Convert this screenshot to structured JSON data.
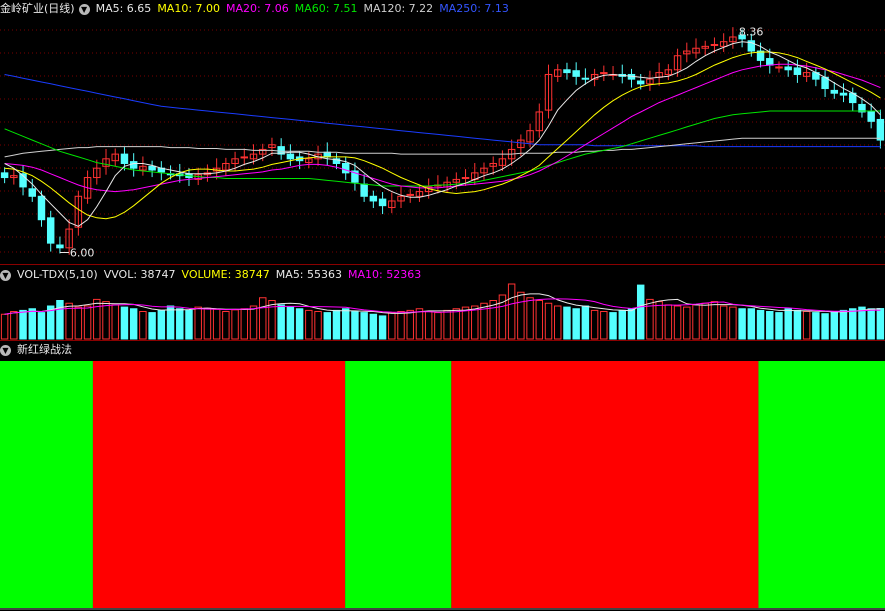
{
  "colors": {
    "up": "#ff3232",
    "down": "#54ffff",
    "ma5": "#e8e8e8",
    "ma10": "#ffff00",
    "ma20": "#ff00ff",
    "ma60": "#00e600",
    "ma120": "#cfcfcf",
    "ma250": "#1a3cff",
    "green": "#00ff00",
    "red": "#ff0000",
    "grid": "#7a0000"
  },
  "price_header": {
    "symbol": "金岭矿业(日线)",
    "ma5": "MA5: 6.65",
    "ma10": "MA10: 7.00",
    "ma20": "MA20: 7.06",
    "ma60": "MA60: 7.51",
    "ma120": "MA120: 7.22",
    "ma250": "MA250: 7.13"
  },
  "vol_header": {
    "name": "VOL-TDX(5,10)",
    "vvol": "VVOL: 38747",
    "volume": "VOLUME: 38747",
    "ma5": "MA5: 55363",
    "ma10": "MA10: 52363"
  },
  "rg_header": {
    "name": "新红绿战法"
  },
  "annotations": {
    "high_label": "8.36",
    "low_label": "6.00"
  },
  "chart_data": [
    {
      "type": "candlestick",
      "title": "金岭矿业(日线)",
      "ylim": [
        5.92,
        8.46
      ],
      "ma_last": {
        "MA5": 6.65,
        "MA10": 7.0,
        "MA20": 7.06,
        "MA60": 7.51,
        "MA120": 7.22,
        "MA250": 7.13
      },
      "closes": [
        6.8,
        6.82,
        6.7,
        6.6,
        6.35,
        6.1,
        6.05,
        6.25,
        6.6,
        6.8,
        6.9,
        7.0,
        7.05,
        6.95,
        6.9,
        6.92,
        6.88,
        6.86,
        6.84,
        6.82,
        6.8,
        6.83,
        6.85,
        6.9,
        6.95,
        7.0,
        7.02,
        7.05,
        7.1,
        7.15,
        7.05,
        7.0,
        6.98,
        7.0,
        7.05,
        7.02,
        6.95,
        6.85,
        6.75,
        6.6,
        6.55,
        6.5,
        6.55,
        6.6,
        6.62,
        6.65,
        6.7,
        6.72,
        6.75,
        6.78,
        6.8,
        6.85,
        6.9,
        6.95,
        7.0,
        7.1,
        7.2,
        7.3,
        7.5,
        7.9,
        7.95,
        7.92,
        7.88,
        7.85,
        7.9,
        7.92,
        7.9,
        7.88,
        7.85,
        7.8,
        7.85,
        7.92,
        7.95,
        8.1,
        8.15,
        8.18,
        8.2,
        8.22,
        8.25,
        8.3,
        8.28,
        8.15,
        8.05,
        8.0,
        7.98,
        7.95,
        7.9,
        7.92,
        7.85,
        7.75,
        7.7,
        7.68,
        7.6,
        7.5,
        7.4,
        7.2
      ],
      "ma5": [
        6.95,
        6.9,
        6.82,
        6.73,
        6.62,
        6.52,
        6.42,
        6.32,
        6.28,
        6.35,
        6.49,
        6.65,
        6.82,
        6.92,
        6.95,
        6.95,
        6.93,
        6.9,
        6.88,
        6.86,
        6.84,
        6.84,
        6.84,
        6.85,
        6.87,
        6.9,
        6.94,
        6.97,
        7.01,
        7.06,
        7.06,
        7.07,
        7.07,
        7.05,
        7.02,
        7.0,
        6.99,
        6.97,
        6.93,
        6.85,
        6.77,
        6.7,
        6.65,
        6.61,
        6.59,
        6.59,
        6.61,
        6.64,
        6.67,
        6.71,
        6.74,
        6.78,
        6.82,
        6.85,
        6.89,
        6.95,
        7.02,
        7.1,
        7.2,
        7.35,
        7.52,
        7.63,
        7.73,
        7.8,
        7.86,
        7.89,
        7.9,
        7.89,
        7.88,
        7.87,
        7.86,
        7.87,
        7.88,
        7.92,
        7.97,
        8.04,
        8.1,
        8.15,
        8.19,
        8.23,
        8.25,
        8.24,
        8.2,
        8.14,
        8.1,
        8.05,
        8.0,
        7.97,
        7.92,
        7.87,
        7.81,
        7.75,
        7.7,
        7.64,
        7.57,
        7.47
      ],
      "ma10": [
        6.9,
        6.89,
        6.86,
        6.82,
        6.76,
        6.69,
        6.61,
        6.53,
        6.46,
        6.4,
        6.37,
        6.36,
        6.38,
        6.43,
        6.5,
        6.58,
        6.66,
        6.74,
        6.8,
        6.85,
        6.88,
        6.89,
        6.89,
        6.88,
        6.87,
        6.87,
        6.88,
        6.89,
        6.91,
        6.94,
        6.96,
        6.98,
        7.0,
        7.01,
        7.02,
        7.02,
        7.02,
        7.02,
        7.01,
        6.98,
        6.94,
        6.9,
        6.85,
        6.8,
        6.76,
        6.72,
        6.68,
        6.66,
        6.64,
        6.63,
        6.64,
        6.65,
        6.67,
        6.7,
        6.73,
        6.77,
        6.82,
        6.87,
        6.93,
        7.02,
        7.11,
        7.2,
        7.29,
        7.38,
        7.47,
        7.55,
        7.62,
        7.68,
        7.73,
        7.77,
        7.79,
        7.8,
        7.81,
        7.83,
        7.86,
        7.9,
        7.95,
        8.0,
        8.04,
        8.08,
        8.11,
        8.13,
        8.14,
        8.14,
        8.13,
        8.11,
        8.08,
        8.04,
        8.0,
        7.96,
        7.91,
        7.86,
        7.81,
        7.76,
        7.71,
        7.65
      ],
      "ma20": [
        6.95,
        6.94,
        6.93,
        6.91,
        6.88,
        6.84,
        6.8,
        6.76,
        6.72,
        6.69,
        6.67,
        6.66,
        6.65,
        6.66,
        6.67,
        6.69,
        6.71,
        6.73,
        6.75,
        6.77,
        6.78,
        6.79,
        6.8,
        6.81,
        6.82,
        6.83,
        6.84,
        6.85,
        6.86,
        6.88,
        6.89,
        6.91,
        6.93,
        6.94,
        6.94,
        6.93,
        6.91,
        6.88,
        6.85,
        6.82,
        6.79,
        6.76,
        6.73,
        6.71,
        6.7,
        6.69,
        6.69,
        6.69,
        6.7,
        6.71,
        6.72,
        6.73,
        6.74,
        6.75,
        6.76,
        6.78,
        6.8,
        6.83,
        6.87,
        6.92,
        6.97,
        7.03,
        7.09,
        7.15,
        7.21,
        7.27,
        7.33,
        7.39,
        7.45,
        7.5,
        7.55,
        7.6,
        7.64,
        7.68,
        7.72,
        7.76,
        7.8,
        7.84,
        7.88,
        7.92,
        7.95,
        7.97,
        7.99,
        8.0,
        8.01,
        8.01,
        8.0,
        7.99,
        7.97,
        7.95,
        7.93,
        7.9,
        7.87,
        7.84,
        7.8,
        7.76
      ],
      "ma60": [
        7.32,
        7.28,
        7.24,
        7.2,
        7.16,
        7.12,
        7.08,
        7.05,
        7.02,
        6.99,
        6.96,
        6.94,
        6.92,
        6.9,
        6.88,
        6.87,
        6.86,
        6.85,
        6.84,
        6.83,
        6.82,
        6.81,
        6.8,
        6.8,
        6.79,
        6.79,
        6.79,
        6.79,
        6.79,
        6.79,
        6.79,
        6.79,
        6.79,
        6.79,
        6.78,
        6.77,
        6.76,
        6.75,
        6.74,
        6.73,
        6.72,
        6.71,
        6.71,
        6.71,
        6.71,
        6.71,
        6.71,
        6.72,
        6.72,
        6.73,
        6.74,
        6.75,
        6.77,
        6.79,
        6.81,
        6.83,
        6.85,
        6.87,
        6.9,
        6.93,
        6.96,
        6.99,
        7.02,
        7.05,
        7.07,
        7.09,
        7.11,
        7.13,
        7.16,
        7.19,
        7.22,
        7.25,
        7.28,
        7.31,
        7.34,
        7.37,
        7.4,
        7.43,
        7.45,
        7.47,
        7.48,
        7.49,
        7.5,
        7.51,
        7.51,
        7.51,
        7.51,
        7.51,
        7.51,
        7.51,
        7.51,
        7.51,
        7.51,
        7.51,
        7.51,
        7.51
      ],
      "ma120": [
        7.02,
        7.04,
        7.06,
        7.07,
        7.08,
        7.09,
        7.1,
        7.11,
        7.12,
        7.12,
        7.13,
        7.13,
        7.13,
        7.13,
        7.13,
        7.13,
        7.13,
        7.13,
        7.12,
        7.12,
        7.12,
        7.11,
        7.11,
        7.11,
        7.1,
        7.1,
        7.1,
        7.09,
        7.09,
        7.09,
        7.08,
        7.08,
        7.08,
        7.08,
        7.07,
        7.07,
        7.07,
        7.06,
        7.06,
        7.06,
        7.06,
        7.06,
        7.06,
        7.05,
        7.05,
        7.05,
        7.05,
        7.05,
        7.05,
        7.05,
        7.05,
        7.05,
        7.05,
        7.05,
        7.05,
        7.05,
        7.06,
        7.06,
        7.06,
        7.06,
        7.07,
        7.07,
        7.07,
        7.08,
        7.08,
        7.09,
        7.09,
        7.1,
        7.1,
        7.11,
        7.12,
        7.13,
        7.14,
        7.15,
        7.16,
        7.17,
        7.18,
        7.19,
        7.2,
        7.21,
        7.22,
        7.22,
        7.22,
        7.22,
        7.22,
        7.22,
        7.22,
        7.22,
        7.22,
        7.22,
        7.22,
        7.22,
        7.22,
        7.22,
        7.22,
        7.22
      ],
      "ma250": [
        7.9,
        7.88,
        7.86,
        7.84,
        7.82,
        7.8,
        7.78,
        7.76,
        7.74,
        7.72,
        7.7,
        7.68,
        7.66,
        7.64,
        7.62,
        7.6,
        7.58,
        7.56,
        7.55,
        7.54,
        7.53,
        7.52,
        7.51,
        7.5,
        7.49,
        7.48,
        7.47,
        7.46,
        7.45,
        7.44,
        7.43,
        7.42,
        7.41,
        7.4,
        7.39,
        7.38,
        7.37,
        7.36,
        7.35,
        7.34,
        7.33,
        7.32,
        7.31,
        7.3,
        7.29,
        7.28,
        7.27,
        7.26,
        7.25,
        7.24,
        7.23,
        7.22,
        7.21,
        7.2,
        7.19,
        7.18,
        7.17,
        7.16,
        7.15,
        7.15,
        7.15,
        7.15,
        7.15,
        7.15,
        7.14,
        7.14,
        7.14,
        7.14,
        7.14,
        7.14,
        7.14,
        7.14,
        7.14,
        7.14,
        7.14,
        7.14,
        7.13,
        7.13,
        7.13,
        7.13,
        7.13,
        7.13,
        7.13,
        7.13,
        7.13,
        7.13,
        7.13,
        7.13,
        7.13,
        7.13,
        7.13,
        7.13,
        7.13,
        7.13,
        7.13,
        7.13
      ]
    },
    {
      "type": "bar",
      "title": "VOL-TDX(5,10)",
      "ylim": [
        0,
        100000
      ],
      "volumes": [
        45000,
        50000,
        52000,
        55000,
        48000,
        60000,
        70000,
        65000,
        58000,
        60000,
        72000,
        68000,
        62000,
        58000,
        55000,
        50000,
        48000,
        52000,
        60000,
        55000,
        52000,
        58000,
        56000,
        54000,
        50000,
        53000,
        55000,
        60000,
        75000,
        70000,
        62000,
        58000,
        55000,
        52000,
        50000,
        48000,
        52000,
        55000,
        50000,
        48000,
        45000,
        42000,
        48000,
        50000,
        52000,
        55000,
        50000,
        48000,
        52000,
        55000,
        58000,
        60000,
        65000,
        70000,
        80000,
        100000,
        85000,
        75000,
        70000,
        65000,
        60000,
        58000,
        55000,
        60000,
        52000,
        50000,
        48000,
        52000,
        55000,
        98000,
        72000,
        68000,
        62000,
        60000,
        58000,
        62000,
        65000,
        68000,
        60000,
        58000,
        55000,
        55000,
        52000,
        50000,
        48000,
        55000,
        52000,
        50000,
        48000,
        46000,
        50000,
        52000,
        55000,
        58000,
        55000,
        55363
      ],
      "ma5": 55363,
      "ma10": 52363
    },
    {
      "type": "heatmap",
      "title": "新红绿战法",
      "segments": [
        {
          "start": 0,
          "end": 0.105,
          "color": "green"
        },
        {
          "start": 0.105,
          "end": 0.39,
          "color": "red"
        },
        {
          "start": 0.39,
          "end": 0.51,
          "color": "green"
        },
        {
          "start": 0.51,
          "end": 0.857,
          "color": "red"
        },
        {
          "start": 0.857,
          "end": 1,
          "color": "green"
        }
      ]
    }
  ]
}
